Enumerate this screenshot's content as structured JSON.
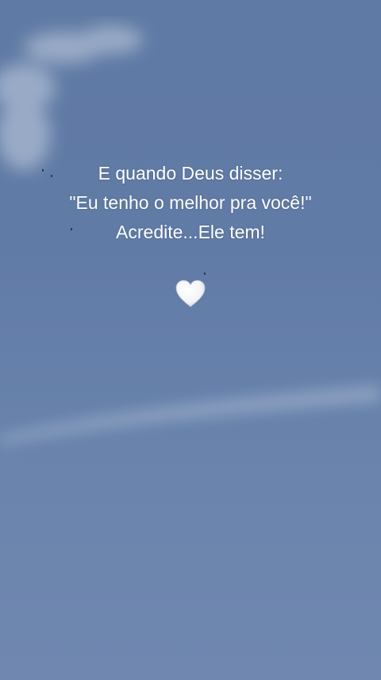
{
  "quote": {
    "line1": "E quando Deus disser:",
    "line2": "\"Eu tenho o melhor pra você!\"",
    "line3": "Acredite...Ele tem!"
  },
  "icons": {
    "heart": "white-heart-icon"
  },
  "colors": {
    "sky_top": "#5f7aa4",
    "sky_bottom": "#7088b0",
    "text": "#ffffff",
    "heart": "#ffffff"
  }
}
